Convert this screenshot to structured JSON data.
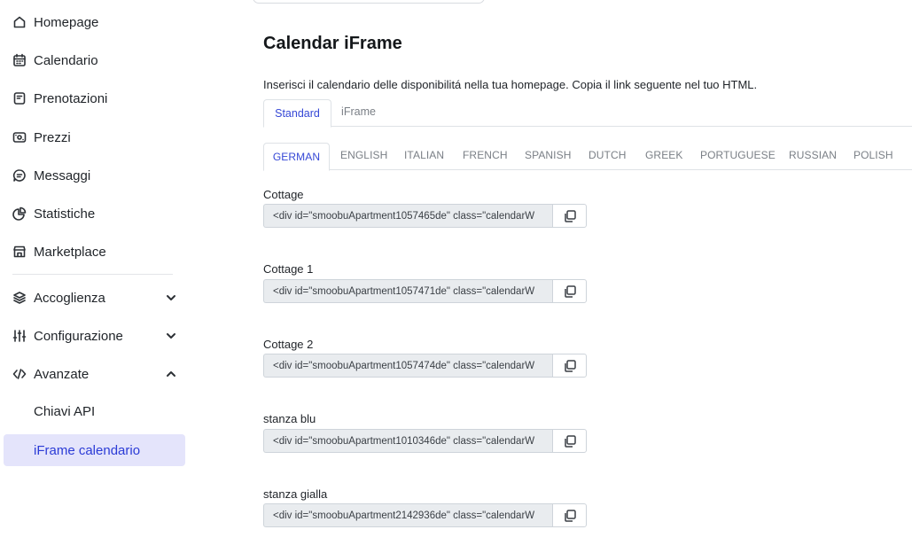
{
  "sidebar": {
    "items": [
      {
        "label": "Homepage",
        "icon": "home-icon"
      },
      {
        "label": "Calendario",
        "icon": "calendar-icon"
      },
      {
        "label": "Prenotazioni",
        "icon": "bookings-icon"
      },
      {
        "label": "Prezzi",
        "icon": "prices-icon"
      },
      {
        "label": "Messaggi",
        "icon": "message-icon"
      },
      {
        "label": "Statistiche",
        "icon": "chart-pie-icon"
      },
      {
        "label": "Marketplace",
        "icon": "store-icon"
      }
    ],
    "groups": [
      {
        "label": "Accoglienza",
        "icon": "layers-icon",
        "expanded": false
      },
      {
        "label": "Configurazione",
        "icon": "sliders-icon",
        "expanded": false
      },
      {
        "label": "Avanzate",
        "icon": "code-icon",
        "expanded": true
      }
    ],
    "sub_items": [
      {
        "label": "Chiavi API",
        "active": false
      },
      {
        "label": "iFrame calendario",
        "active": true
      }
    ]
  },
  "main": {
    "title": "Calendar iFrame",
    "description": "Inserisci il calendario delle disponibilitá nella tua homepage. Copia il link seguente nel tuo HTML.",
    "mode_tabs": [
      {
        "label": "Standard",
        "active": true
      },
      {
        "label": "iFrame",
        "active": false
      }
    ],
    "language_tabs": [
      {
        "label": "GERMAN",
        "active": true
      },
      {
        "label": "ENGLISH",
        "active": false
      },
      {
        "label": "ITALIAN",
        "active": false
      },
      {
        "label": "FRENCH",
        "active": false
      },
      {
        "label": "SPANISH",
        "active": false
      },
      {
        "label": "DUTCH",
        "active": false
      },
      {
        "label": "GREEK",
        "active": false
      },
      {
        "label": "PORTUGUESE",
        "active": false
      },
      {
        "label": "RUSSIAN",
        "active": false
      },
      {
        "label": "POLISH",
        "active": false
      }
    ],
    "apartments": [
      {
        "name": "Cottage",
        "code": "<div id=\"smoobuApartment1057465de\" class=\"calendarW"
      },
      {
        "name": "Cottage 1",
        "code": "<div id=\"smoobuApartment1057471de\" class=\"calendarW"
      },
      {
        "name": "Cottage 2",
        "code": "<div id=\"smoobuApartment1057474de\" class=\"calendarW"
      },
      {
        "name": "stanza blu",
        "code": "<div id=\"smoobuApartment1010346de\" class=\"calendarW"
      },
      {
        "name": "stanza gialla",
        "code": "<div id=\"smoobuApartment2142936de\" class=\"calendarW"
      }
    ]
  },
  "colors": {
    "accent": "#3547d6",
    "active_bg": "#e4e4fb",
    "input_bg": "#e9ecef"
  }
}
